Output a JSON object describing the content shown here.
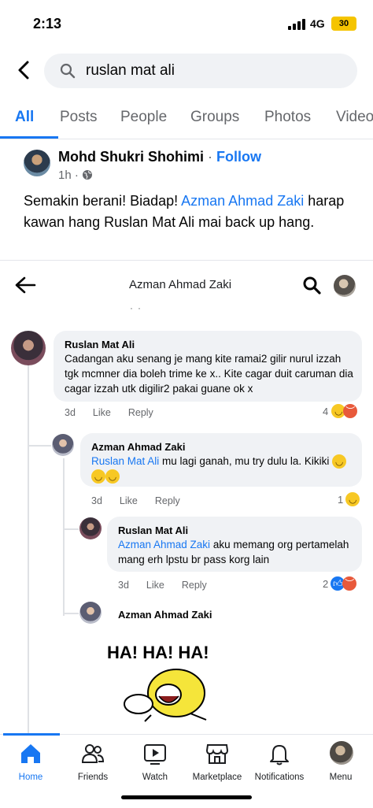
{
  "status_bar": {
    "time": "2:13",
    "network": "4G",
    "battery": "30"
  },
  "search": {
    "query": "ruslan mat ali"
  },
  "tabs": [
    {
      "label": "All",
      "active": true
    },
    {
      "label": "Posts"
    },
    {
      "label": "People"
    },
    {
      "label": "Groups"
    },
    {
      "label": "Photos"
    },
    {
      "label": "Video"
    }
  ],
  "post": {
    "author": "Mohd Shukri Shohimi",
    "separator": "·",
    "follow_label": "Follow",
    "time": "1h ·",
    "text_before": "Semakin berani! Biadap! ",
    "text_mention": "Azman Ahmad Zaki",
    "text_after": " harap kawan hang Ruslan Mat Ali mai back up hang."
  },
  "embedded": {
    "title": "Azman Ahmad Zaki",
    "comments": [
      {
        "name": "Ruslan Mat Ali",
        "text": "Cadangan aku senang je mang kite ramai2 gilir nurul izzah tgk mcmner dia boleh trime ke x.. Kite cagar duit caruman dia cagar izzah utk digilir2 pakai guane ok x",
        "time": "3d",
        "like": "Like",
        "reply": "Reply",
        "reactions": "4"
      },
      {
        "name": "Azman Ahmad Zaki",
        "mention": "Ruslan Mat Ali",
        "text": " mu lagi ganah, mu try dulu la. Kikiki",
        "time": "3d",
        "like": "Like",
        "reply": "Reply",
        "reactions": "1"
      },
      {
        "name": "Ruslan Mat Ali",
        "mention": "Azman Ahmad Zaki",
        "text": " aku memang org pertamelah mang erh lpstu br pass korg lain",
        "time": "3d",
        "like": "Like",
        "reply": "Reply",
        "reactions": "2"
      },
      {
        "name": "Azman Ahmad Zaki",
        "sticker_text": "HA! HA! HA!"
      }
    ]
  },
  "nav": [
    {
      "label": "Home",
      "icon": "home-icon",
      "active": true
    },
    {
      "label": "Friends",
      "icon": "friends-icon"
    },
    {
      "label": "Watch",
      "icon": "watch-icon"
    },
    {
      "label": "Marketplace",
      "icon": "marketplace-icon"
    },
    {
      "label": "Notifications",
      "icon": "bell-icon"
    },
    {
      "label": "Menu",
      "icon": "menu-avatar-icon"
    }
  ],
  "colors": {
    "accent": "#1877f2",
    "bubble": "#f0f2f5",
    "muted": "#65676b"
  }
}
